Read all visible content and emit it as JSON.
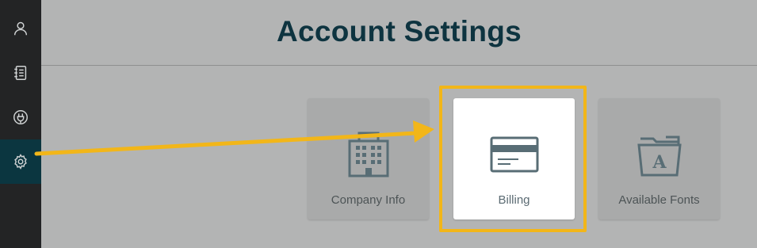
{
  "page": {
    "title": "Account Settings"
  },
  "sidebar": {
    "items": [
      {
        "icon": "person-icon"
      },
      {
        "icon": "notebook-icon"
      },
      {
        "icon": "plug-icon"
      },
      {
        "icon": "gear-icon",
        "active": true
      }
    ]
  },
  "cards": [
    {
      "label": "Company Info",
      "icon": "building-icon"
    },
    {
      "label": "Billing",
      "icon": "credit-card-icon",
      "highlighted": true
    },
    {
      "label": "Available Fonts",
      "icon": "font-folder-icon"
    }
  ],
  "colors": {
    "sidebar_bg": "#232425",
    "sidebar_active": "#0b3640",
    "title": "#0e3440",
    "highlight": "#f2b619",
    "icon": "#586d75"
  }
}
